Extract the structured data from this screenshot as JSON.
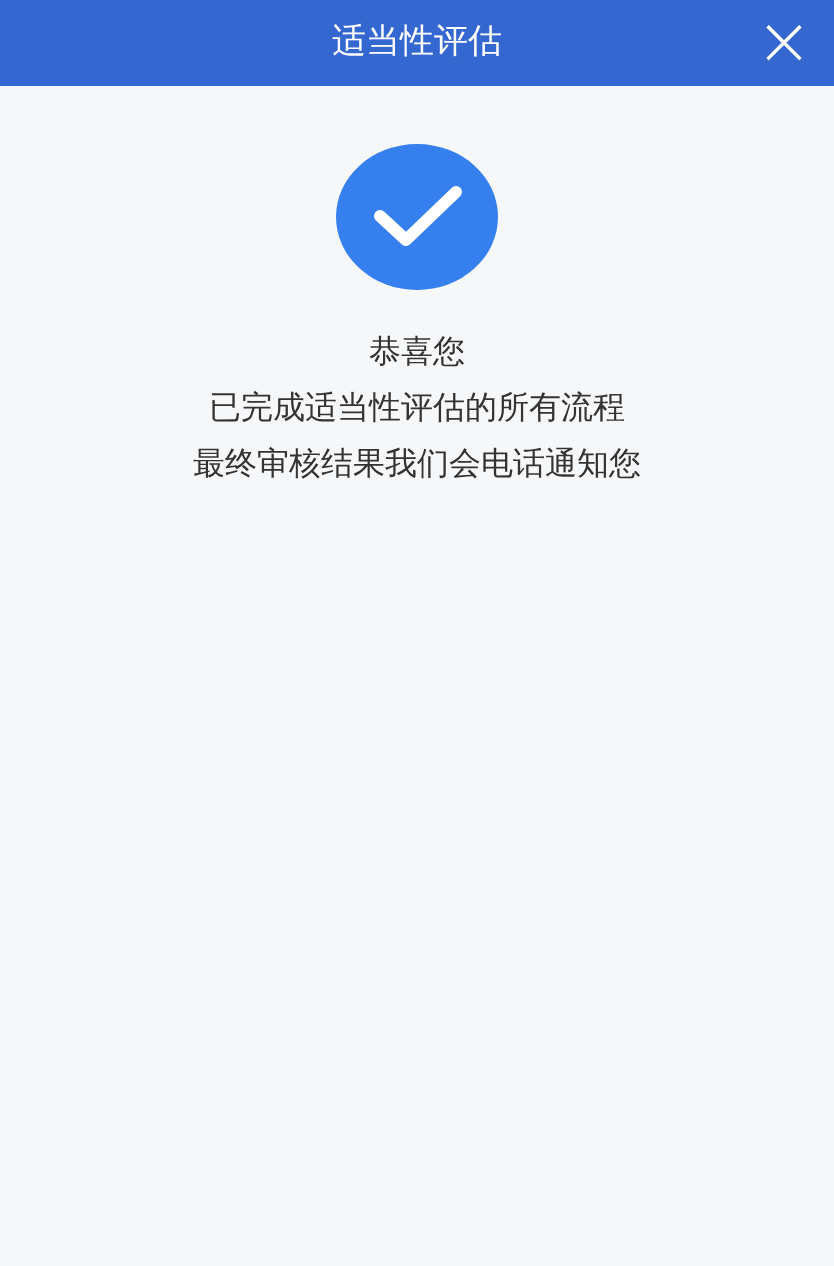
{
  "header": {
    "title": "适当性评估",
    "close_icon": "×"
  },
  "result": {
    "lines": [
      "恭喜您",
      "已完成适当性评估的所有流程",
      "最终审核结果我们会电话通知您"
    ]
  }
}
